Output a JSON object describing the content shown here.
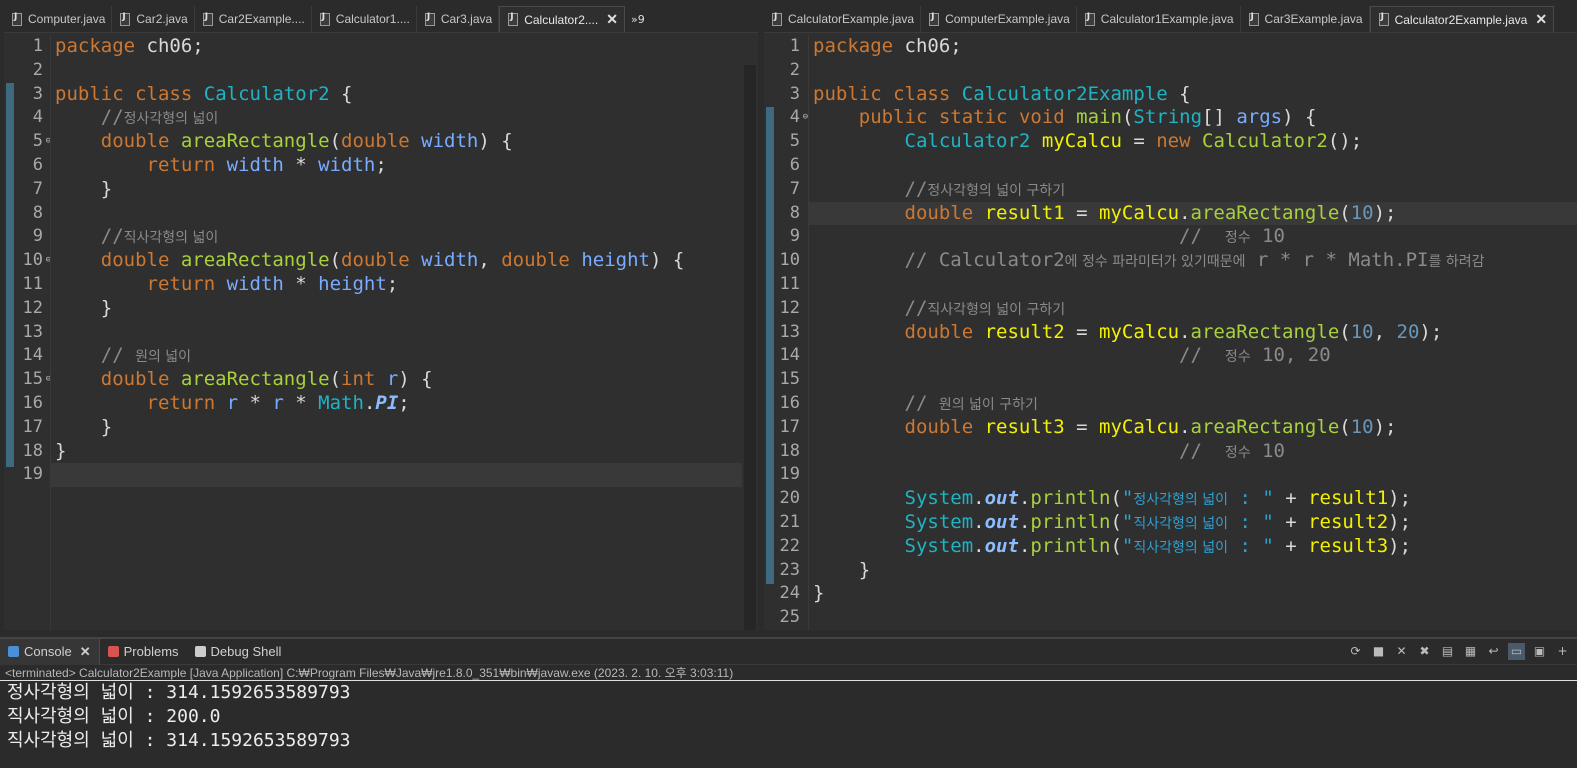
{
  "left_editor": {
    "tabs": [
      {
        "label": "Computer.java",
        "active": false
      },
      {
        "label": "Car2.java",
        "active": false
      },
      {
        "label": "Car2Example....",
        "active": false
      },
      {
        "label": "Calculator1....",
        "active": false
      },
      {
        "label": "Car3.java",
        "active": false
      },
      {
        "label": "Calculator2....",
        "active": true
      }
    ],
    "overflow_label": "»9",
    "current_line": 19,
    "lines": [
      {
        "n": "1",
        "parts": [
          [
            "kw",
            "package"
          ],
          [
            "pln",
            " ch06;"
          ]
        ]
      },
      {
        "n": "2",
        "parts": []
      },
      {
        "n": "3",
        "parts": [
          [
            "kw",
            "public"
          ],
          [
            "pln",
            " "
          ],
          [
            "kw",
            "class"
          ],
          [
            "pln",
            " "
          ],
          [
            "cls",
            "Calculator2"
          ],
          [
            "pln",
            " {"
          ]
        ]
      },
      {
        "n": "4",
        "parts": [
          [
            "pln",
            "    "
          ],
          [
            "cmt",
            "//"
          ],
          [
            "cmt ko",
            "정사각형의 넓이"
          ]
        ]
      },
      {
        "n": "5",
        "fold": true,
        "parts": [
          [
            "pln",
            "    "
          ],
          [
            "kw",
            "double"
          ],
          [
            "pln",
            " "
          ],
          [
            "mth",
            "areaRectangle"
          ],
          [
            "pln",
            "("
          ],
          [
            "kw",
            "double"
          ],
          [
            "pln",
            " "
          ],
          [
            "var",
            "width"
          ],
          [
            "pln",
            ") {"
          ]
        ]
      },
      {
        "n": "6",
        "parts": [
          [
            "pln",
            "        "
          ],
          [
            "kw",
            "return"
          ],
          [
            "pln",
            " "
          ],
          [
            "var",
            "width"
          ],
          [
            "pln",
            " * "
          ],
          [
            "var",
            "width"
          ],
          [
            "pln",
            ";"
          ]
        ]
      },
      {
        "n": "7",
        "parts": [
          [
            "pln",
            "    }"
          ]
        ]
      },
      {
        "n": "8",
        "parts": []
      },
      {
        "n": "9",
        "parts": [
          [
            "pln",
            "    "
          ],
          [
            "cmt",
            "//"
          ],
          [
            "cmt ko",
            "직사각형의 넓이"
          ]
        ]
      },
      {
        "n": "10",
        "fold": true,
        "parts": [
          [
            "pln",
            "    "
          ],
          [
            "kw",
            "double"
          ],
          [
            "pln",
            " "
          ],
          [
            "mth",
            "areaRectangle"
          ],
          [
            "pln",
            "("
          ],
          [
            "kw",
            "double"
          ],
          [
            "pln",
            " "
          ],
          [
            "var",
            "width"
          ],
          [
            "pln",
            ", "
          ],
          [
            "kw",
            "double"
          ],
          [
            "pln",
            " "
          ],
          [
            "var",
            "height"
          ],
          [
            "pln",
            ") {"
          ]
        ]
      },
      {
        "n": "11",
        "parts": [
          [
            "pln",
            "        "
          ],
          [
            "kw",
            "return"
          ],
          [
            "pln",
            " "
          ],
          [
            "var",
            "width"
          ],
          [
            "pln",
            " * "
          ],
          [
            "var",
            "height"
          ],
          [
            "pln",
            ";"
          ]
        ]
      },
      {
        "n": "12",
        "parts": [
          [
            "pln",
            "    }"
          ]
        ]
      },
      {
        "n": "13",
        "parts": []
      },
      {
        "n": "14",
        "parts": [
          [
            "pln",
            "    "
          ],
          [
            "cmt",
            "// "
          ],
          [
            "cmt ko",
            "원의 넓이"
          ]
        ]
      },
      {
        "n": "15",
        "fold": true,
        "parts": [
          [
            "pln",
            "    "
          ],
          [
            "kw",
            "double"
          ],
          [
            "pln",
            " "
          ],
          [
            "mth",
            "areaRectangle"
          ],
          [
            "pln",
            "("
          ],
          [
            "kw",
            "int"
          ],
          [
            "pln",
            " "
          ],
          [
            "var",
            "r"
          ],
          [
            "pln",
            ") {"
          ]
        ]
      },
      {
        "n": "16",
        "parts": [
          [
            "pln",
            "        "
          ],
          [
            "kw",
            "return"
          ],
          [
            "pln",
            " "
          ],
          [
            "var",
            "r"
          ],
          [
            "pln",
            " * "
          ],
          [
            "var",
            "r"
          ],
          [
            "pln",
            " * "
          ],
          [
            "cls",
            "Math"
          ],
          [
            "pln",
            "."
          ],
          [
            "fld",
            "PI"
          ],
          [
            "pln",
            ";"
          ]
        ]
      },
      {
        "n": "17",
        "parts": [
          [
            "pln",
            "    }"
          ]
        ]
      },
      {
        "n": "18",
        "parts": [
          [
            "pln",
            "}"
          ]
        ]
      },
      {
        "n": "19",
        "parts": []
      }
    ]
  },
  "right_editor": {
    "tabs": [
      {
        "label": "CalculatorExample.java",
        "active": false
      },
      {
        "label": "ComputerExample.java",
        "active": false
      },
      {
        "label": "Calculator1Example.java",
        "active": false
      },
      {
        "label": "Car3Example.java",
        "active": false
      },
      {
        "label": "Calculator2Example.java",
        "active": true
      }
    ],
    "current_line": 8,
    "lines": [
      {
        "n": "1",
        "parts": [
          [
            "kw",
            "package"
          ],
          [
            "pln",
            " ch06;"
          ]
        ]
      },
      {
        "n": "2",
        "parts": []
      },
      {
        "n": "3",
        "parts": [
          [
            "kw",
            "public"
          ],
          [
            "pln",
            " "
          ],
          [
            "kw",
            "class"
          ],
          [
            "pln",
            " "
          ],
          [
            "cls",
            "Calculator2Example"
          ],
          [
            "pln",
            " {"
          ]
        ]
      },
      {
        "n": "4",
        "fold": true,
        "parts": [
          [
            "pln",
            "    "
          ],
          [
            "kw",
            "public"
          ],
          [
            "pln",
            " "
          ],
          [
            "kw",
            "static"
          ],
          [
            "pln",
            " "
          ],
          [
            "kw",
            "void"
          ],
          [
            "pln",
            " "
          ],
          [
            "mth",
            "main"
          ],
          [
            "pln",
            "("
          ],
          [
            "cls",
            "String"
          ],
          [
            "pln",
            "[] "
          ],
          [
            "var",
            "args"
          ],
          [
            "pln",
            ") {"
          ]
        ]
      },
      {
        "n": "5",
        "parts": [
          [
            "pln",
            "        "
          ],
          [
            "cls",
            "Calculator2"
          ],
          [
            "pln",
            " "
          ],
          [
            "loc",
            "myCalcu"
          ],
          [
            "pln",
            " = "
          ],
          [
            "kw",
            "new"
          ],
          [
            "pln",
            " "
          ],
          [
            "mth",
            "Calculator2"
          ],
          [
            "pln",
            "();"
          ]
        ]
      },
      {
        "n": "6",
        "parts": []
      },
      {
        "n": "7",
        "parts": [
          [
            "pln",
            "        "
          ],
          [
            "cmt",
            "//"
          ],
          [
            "cmt ko",
            "정사각형의 넓이 구하기"
          ]
        ]
      },
      {
        "n": "8",
        "parts": [
          [
            "pln",
            "        "
          ],
          [
            "kw",
            "double"
          ],
          [
            "pln",
            " "
          ],
          [
            "loc",
            "result1"
          ],
          [
            "pln",
            " = "
          ],
          [
            "loc",
            "myCalcu"
          ],
          [
            "pln",
            "."
          ],
          [
            "mth",
            "areaRectangle"
          ],
          [
            "pln",
            "("
          ],
          [
            "num",
            "10"
          ],
          [
            "pln",
            ");"
          ]
        ]
      },
      {
        "n": "9",
        "parts": [
          [
            "pln",
            "                                "
          ],
          [
            "cmt",
            "//  "
          ],
          [
            "cmt ko",
            "정수"
          ],
          [
            "cmt",
            " 10"
          ]
        ]
      },
      {
        "n": "10",
        "parts": [
          [
            "pln",
            "        "
          ],
          [
            "cmt",
            "// Calculator2"
          ],
          [
            "cmt ko",
            "에 정수 파라미터가 있기때문에"
          ],
          [
            "cmt",
            " r * r * Math.PI"
          ],
          [
            "cmt ko",
            "를 하려감"
          ]
        ]
      },
      {
        "n": "11",
        "parts": []
      },
      {
        "n": "12",
        "parts": [
          [
            "pln",
            "        "
          ],
          [
            "cmt",
            "//"
          ],
          [
            "cmt ko",
            "직사각형의 넓이 구하기"
          ]
        ]
      },
      {
        "n": "13",
        "parts": [
          [
            "pln",
            "        "
          ],
          [
            "kw",
            "double"
          ],
          [
            "pln",
            " "
          ],
          [
            "loc",
            "result2"
          ],
          [
            "pln",
            " = "
          ],
          [
            "loc",
            "myCalcu"
          ],
          [
            "pln",
            "."
          ],
          [
            "mth",
            "areaRectangle"
          ],
          [
            "pln",
            "("
          ],
          [
            "num",
            "10"
          ],
          [
            "pln",
            ", "
          ],
          [
            "num",
            "20"
          ],
          [
            "pln",
            ");"
          ]
        ]
      },
      {
        "n": "14",
        "parts": [
          [
            "pln",
            "                                "
          ],
          [
            "cmt",
            "//  "
          ],
          [
            "cmt ko",
            "정수"
          ],
          [
            "cmt",
            " 10, 20"
          ]
        ]
      },
      {
        "n": "15",
        "parts": []
      },
      {
        "n": "16",
        "parts": [
          [
            "pln",
            "        "
          ],
          [
            "cmt",
            "// "
          ],
          [
            "cmt ko",
            "원의 넓이 구하기"
          ]
        ]
      },
      {
        "n": "17",
        "parts": [
          [
            "pln",
            "        "
          ],
          [
            "kw",
            "double"
          ],
          [
            "pln",
            " "
          ],
          [
            "loc",
            "result3"
          ],
          [
            "pln",
            " = "
          ],
          [
            "loc",
            "myCalcu"
          ],
          [
            "pln",
            "."
          ],
          [
            "mth",
            "areaRectangle"
          ],
          [
            "pln",
            "("
          ],
          [
            "num",
            "10"
          ],
          [
            "pln",
            ");"
          ]
        ]
      },
      {
        "n": "18",
        "parts": [
          [
            "pln",
            "                                "
          ],
          [
            "cmt",
            "//  "
          ],
          [
            "cmt ko",
            "정수"
          ],
          [
            "cmt",
            " 10"
          ]
        ]
      },
      {
        "n": "19",
        "parts": []
      },
      {
        "n": "20",
        "parts": [
          [
            "pln",
            "        "
          ],
          [
            "cls",
            "System"
          ],
          [
            "pln",
            "."
          ],
          [
            "fld",
            "out"
          ],
          [
            "pln",
            "."
          ],
          [
            "mth",
            "println"
          ],
          [
            "pln",
            "("
          ],
          [
            "str",
            "\""
          ],
          [
            "str ko",
            "정사각형의 넓이"
          ],
          [
            "str",
            " : \""
          ],
          [
            "pln",
            " + "
          ],
          [
            "loc",
            "result1"
          ],
          [
            "pln",
            ");"
          ]
        ]
      },
      {
        "n": "21",
        "parts": [
          [
            "pln",
            "        "
          ],
          [
            "cls",
            "System"
          ],
          [
            "pln",
            "."
          ],
          [
            "fld",
            "out"
          ],
          [
            "pln",
            "."
          ],
          [
            "mth",
            "println"
          ],
          [
            "pln",
            "("
          ],
          [
            "str",
            "\""
          ],
          [
            "str ko",
            "직사각형의 넓이"
          ],
          [
            "str",
            " : \""
          ],
          [
            "pln",
            " + "
          ],
          [
            "loc",
            "result2"
          ],
          [
            "pln",
            ");"
          ]
        ]
      },
      {
        "n": "22",
        "parts": [
          [
            "pln",
            "        "
          ],
          [
            "cls",
            "System"
          ],
          [
            "pln",
            "."
          ],
          [
            "fld",
            "out"
          ],
          [
            "pln",
            "."
          ],
          [
            "mth",
            "println"
          ],
          [
            "pln",
            "("
          ],
          [
            "str",
            "\""
          ],
          [
            "str ko",
            "직사각형의 넓이"
          ],
          [
            "str",
            " : \""
          ],
          [
            "pln",
            " + "
          ],
          [
            "loc",
            "result3"
          ],
          [
            "pln",
            ");"
          ]
        ]
      },
      {
        "n": "23",
        "parts": [
          [
            "pln",
            "    }"
          ]
        ]
      },
      {
        "n": "24",
        "parts": [
          [
            "pln",
            "}"
          ]
        ]
      },
      {
        "n": "25",
        "parts": []
      }
    ]
  },
  "console": {
    "tabs": [
      {
        "label": "Console",
        "color": "#4a90d9",
        "active": true,
        "closable": true
      },
      {
        "label": "Problems",
        "color": "#d9534f",
        "active": false
      },
      {
        "label": "Debug Shell",
        "color": "#cccccc",
        "active": false
      }
    ],
    "close_glyph": "✕",
    "toolbar_icons": [
      "sync-icon",
      "stop-icon",
      "remove-icon",
      "remove-all-icon",
      "clear-console-icon",
      "scroll-lock-icon",
      "word-wrap-icon",
      "show-on-stdout-icon",
      "show-on-stderr-icon",
      "new-console-icon"
    ],
    "status": "<terminated> Calculator2Example [Java Application] C:₩Program Files₩Java₩jre1.8.0_351₩bin₩javaw.exe (2023. 2. 10. 오후 3:03:11)",
    "output": [
      "정사각형의 넓이 : 314.1592653589793",
      "직사각형의 넓이 : 200.0",
      "직사각형의 넓이 : 314.1592653589793"
    ]
  }
}
